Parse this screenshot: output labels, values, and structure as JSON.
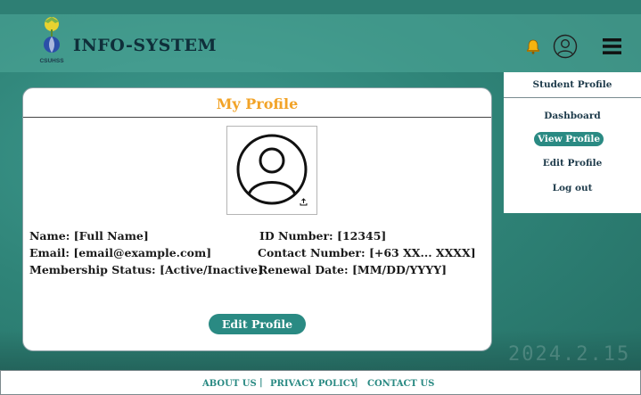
{
  "header": {
    "brand": "INFO-SYSTEM",
    "logo_text": "CSUHSS",
    "icons": [
      "bell-icon",
      "user-icon",
      "menu-icon"
    ]
  },
  "sidebar": {
    "title": "Student Profile",
    "items": [
      {
        "label": "Dashboard"
      },
      {
        "label": "View Profile",
        "active": true
      },
      {
        "label": "Edit Profile"
      },
      {
        "label": "Log out"
      }
    ]
  },
  "profile": {
    "title": "My Profile",
    "name": "Name: [Full Name]",
    "id_number": "ID Number: [12345]",
    "email": "Email: [email@example.com]",
    "contact": "Contact Number: [+63 XX... XXXX]",
    "membership": "Membership Status: [Active/Inactive]",
    "renewal": "Renewal Date: [MM/DD/YYYY]",
    "edit_label": "Edit Profile",
    "upload_icon": "upload-icon"
  },
  "footer": {
    "about": "ABOUT US",
    "privacy": "PRIVACY POLICY",
    "contact": "CONTACT US",
    "sep": "|"
  },
  "background": {
    "date_text": "2024.2.15"
  },
  "colors": {
    "accent": "#2a8a83",
    "title": "#f2a327",
    "bell": "#f5b40f",
    "text": "#1d3a4a"
  }
}
